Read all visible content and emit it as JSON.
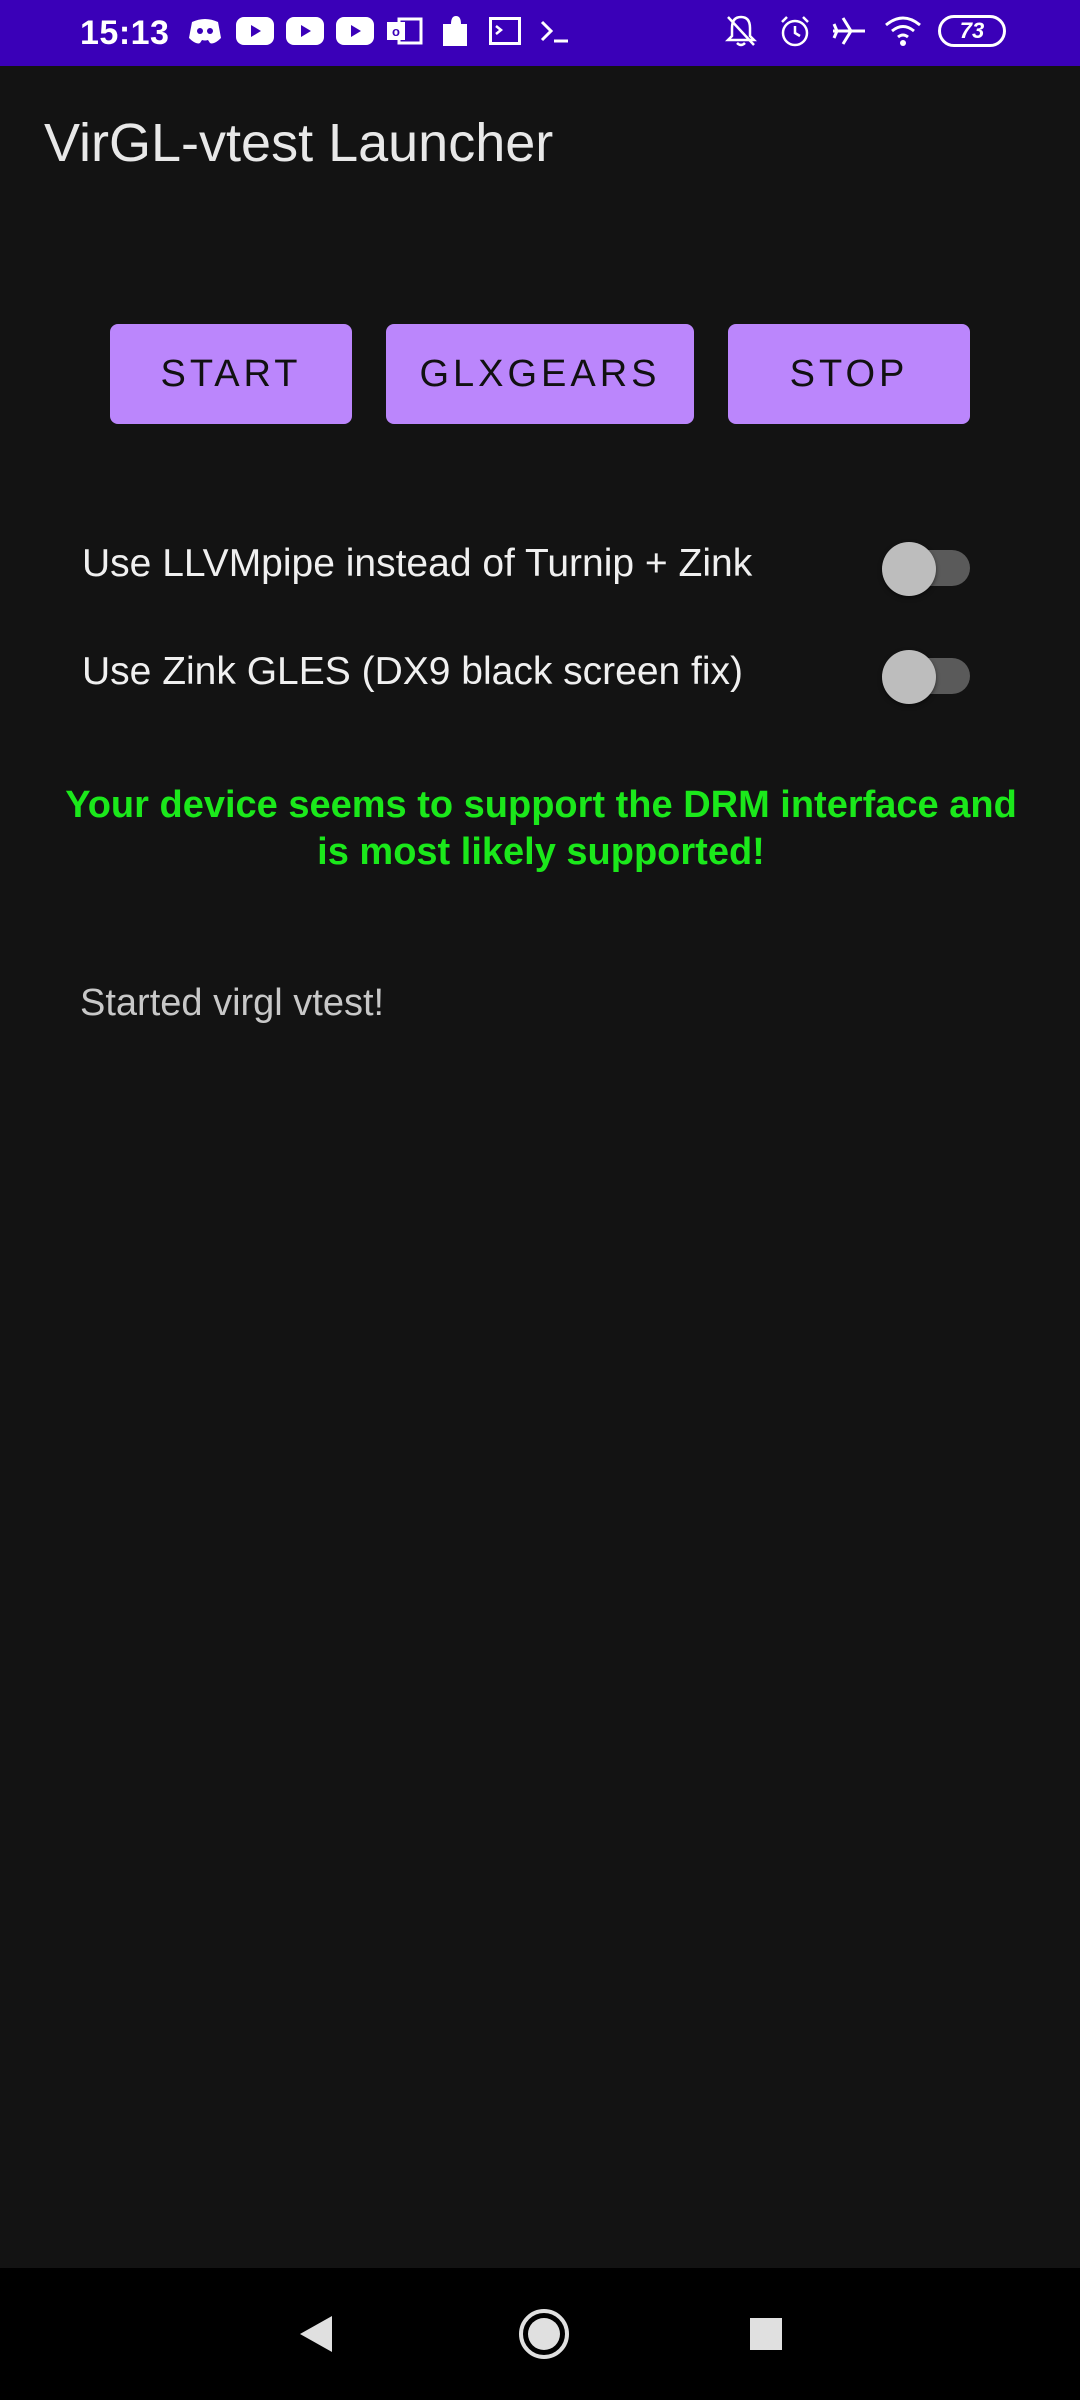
{
  "status_bar": {
    "time": "15:13",
    "left_icons": [
      "discord-icon",
      "youtube-icon",
      "youtube-icon",
      "youtube-icon",
      "outlook-icon",
      "puzzle-icon",
      "terminal-window-icon",
      "terminal-prompt-icon"
    ],
    "right_icons": [
      "bell-off-icon",
      "alarm-icon",
      "airplane-icon",
      "wifi-icon"
    ],
    "battery": "73",
    "bg_color": "#3a00b8"
  },
  "app": {
    "title": "VirGL-vtest Launcher"
  },
  "buttons": {
    "start_label": "START",
    "glxgears_label": "GLXGEARS",
    "stop_label": "STOP",
    "color": "#bb86fc"
  },
  "toggles": [
    {
      "label": "Use LLVMpipe instead of Turnip + Zink",
      "checked": false
    },
    {
      "label": "Use Zink GLES (DX9 black screen fix)",
      "checked": false
    }
  ],
  "support_message": "Your device seems to support the DRM interface and is most likely supported!",
  "support_color": "#1be81b",
  "log": "Started virgl vtest!",
  "nav": {
    "icons": [
      "back-icon",
      "home-icon",
      "recents-icon"
    ]
  }
}
